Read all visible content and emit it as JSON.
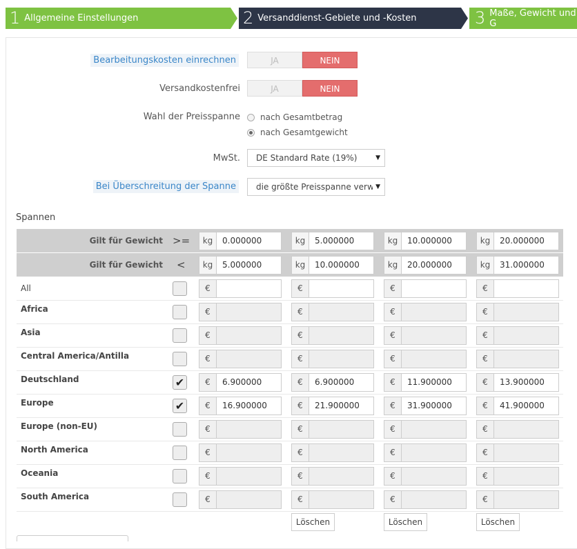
{
  "wizard": {
    "steps": [
      {
        "num": "1",
        "label": "Allgemeine Einstellungen"
      },
      {
        "num": "2",
        "label": "Versanddienst-Gebiete und -Kosten"
      },
      {
        "num": "3",
        "label": "Maße, Gewicht und G"
      }
    ]
  },
  "form": {
    "processing_label": "Bearbeitungskosten einrechnen",
    "free_label": "Versandkostenfrei",
    "toggle_yes": "JA",
    "toggle_no": "NEIN",
    "range_label": "Wahl der Preisspanne",
    "range_opt1": "nach Gesamtbetrag",
    "range_opt2": "nach Gesamtgewicht",
    "vat_label": "MwSt.",
    "vat_value": "DE Standard Rate (19%)",
    "exceed_label": "Bei Überschreitung der Spanne",
    "exceed_value": "die größte Preisspanne verw"
  },
  "spans": {
    "title": "Spannen",
    "row_ge": {
      "label": "Gilt für Gewicht",
      "op": ">=",
      "unit": "kg",
      "values": [
        "0.000000",
        "5.000000",
        "10.000000",
        "20.000000"
      ]
    },
    "row_lt": {
      "label": "Gilt für Gewicht",
      "op": "<",
      "unit": "kg",
      "values": [
        "5.000000",
        "10.000000",
        "20.000000",
        "31.000000"
      ]
    },
    "currency": "€",
    "regions": [
      {
        "name": "All",
        "checked": false,
        "values": [
          "",
          "",
          "",
          ""
        ]
      },
      {
        "name": "Africa",
        "checked": false,
        "values": [
          "",
          "",
          "",
          ""
        ]
      },
      {
        "name": "Asia",
        "checked": false,
        "values": [
          "",
          "",
          "",
          ""
        ]
      },
      {
        "name": "Central America/Antilla",
        "checked": false,
        "values": [
          "",
          "",
          "",
          ""
        ]
      },
      {
        "name": "Deutschland",
        "checked": true,
        "values": [
          "6.900000",
          "6.900000",
          "11.900000",
          "13.900000"
        ]
      },
      {
        "name": "Europe",
        "checked": true,
        "values": [
          "16.900000",
          "21.900000",
          "31.900000",
          "41.900000"
        ]
      },
      {
        "name": "Europe (non-EU)",
        "checked": false,
        "values": [
          "",
          "",
          "",
          ""
        ]
      },
      {
        "name": "North America",
        "checked": false,
        "values": [
          "",
          "",
          "",
          ""
        ]
      },
      {
        "name": "Oceania",
        "checked": false,
        "values": [
          "",
          "",
          "",
          ""
        ]
      },
      {
        "name": "South America",
        "checked": false,
        "values": [
          "",
          "",
          "",
          ""
        ]
      }
    ],
    "delete_label": "Löschen"
  }
}
